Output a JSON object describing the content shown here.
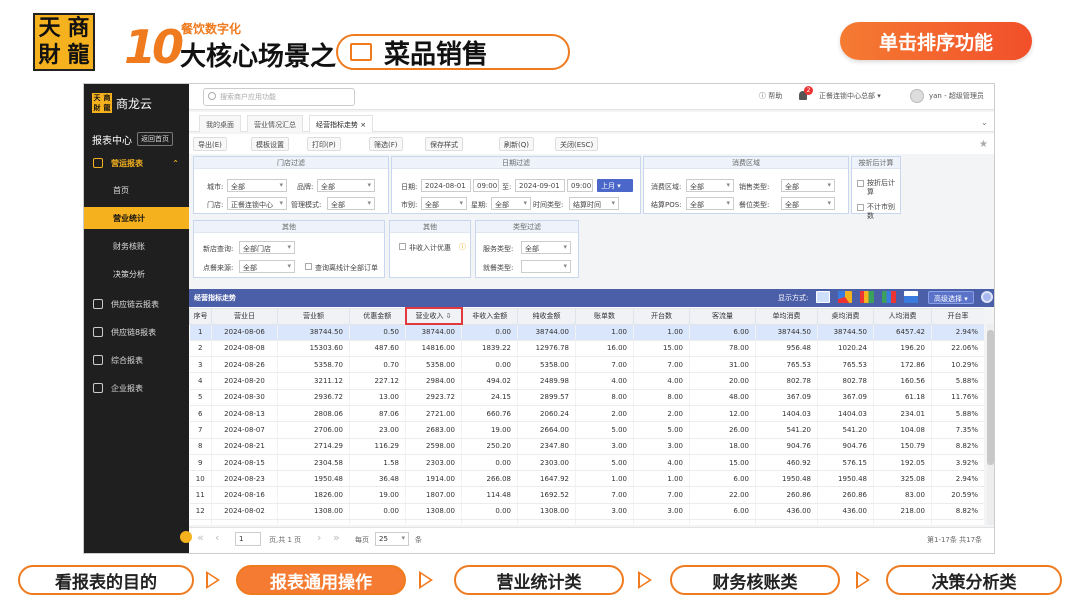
{
  "banner": {
    "logo_chars": [
      "天",
      "商",
      "財",
      "龍"
    ],
    "number": "10",
    "subtitle": "餐饮数字化",
    "title": "大核心场景之",
    "pill_text": "菜品销售",
    "sort_badge": "单击排序功能"
  },
  "sidebar": {
    "brand_chars": [
      "天",
      "商",
      "財",
      "龍"
    ],
    "brand": "商龙云",
    "report_center": "报表中心",
    "home_btn": "返回首页",
    "group": "营运报表",
    "items": [
      {
        "label": "首页",
        "active": false
      },
      {
        "label": "营业统计",
        "active": true
      },
      {
        "label": "财务核账",
        "active": false
      },
      {
        "label": "决策分析",
        "active": false
      }
    ],
    "others": [
      "供应链云报表",
      "供应链8报表",
      "综合报表",
      "企业报表"
    ]
  },
  "topbar": {
    "search_placeholder": "搜索商户应用功能",
    "help": "帮助",
    "bell_count": "2",
    "org": "正餐连锁中心总部",
    "user": "yan - 超级管理员"
  },
  "tabs": [
    "我的桌面",
    "营业情况汇总",
    "经营指标走势"
  ],
  "toolbar": [
    "导出(E)",
    "模板设置",
    "打印(P)",
    "筛选(F)",
    "保存样式",
    "刷新(Q)",
    "关闭(ESC)"
  ],
  "filters": {
    "store": {
      "title": "门店过滤",
      "city_label": "城市:",
      "city": "全部",
      "brand_label": "品牌:",
      "brand": "全部",
      "store_label": "门店:",
      "store": "正餐连锁中心",
      "mgmt_label": "管理模式:",
      "mgmt": "全部"
    },
    "date": {
      "title": "日期过滤",
      "date_label": "日期:",
      "from_date": "2024-08-01",
      "from_time": "09:00",
      "to_label": "至:",
      "to_date": "2024-09-01",
      "to_time": "09:00",
      "month_btn": "上月",
      "meal_label": "市别:",
      "meal": "全部",
      "week_label": "星期:",
      "week": "全部",
      "time_type_label": "时间类型:",
      "time_type": "结算时间"
    },
    "consume": {
      "title": "消费区域",
      "area_label": "消费区域:",
      "area": "全部",
      "sale_type_label": "销售类型:",
      "sale_type": "全部",
      "pos_label": "结算POS:",
      "pos": "全部",
      "seat_label": "餐位类型:",
      "seat": "全部"
    },
    "discount": {
      "title": "按折后计算",
      "opt1": "按折后计算",
      "opt2": "不计市别数"
    },
    "other1": {
      "title": "其他",
      "new_store_label": "新店查询:",
      "new_store": "全部门店",
      "source_label": "点餐来源:",
      "source": "全部",
      "offline_text": "查询离线计全部订单"
    },
    "other2": {
      "title": "其他",
      "opt": "非收入计优惠"
    },
    "type": {
      "title": "类型过滤",
      "service_label": "服务类型:",
      "service": "全部",
      "group_label": "就餐类型:",
      "group": ""
    }
  },
  "grid": {
    "title": "经营指标走势",
    "display_label": "显示方式:",
    "adv_btn": "高级选择",
    "columns": [
      "序号",
      "营业日",
      "营业额",
      "优惠金额",
      "营业收入 ⇩",
      "非收入金额",
      "纯收金额",
      "账单数",
      "开台数",
      "客流量",
      "单均消费",
      "桌均消费",
      "人均消费",
      "开台率"
    ],
    "rows": [
      [
        "1",
        "2024-08-06",
        "38744.50",
        "0.50",
        "38744.00",
        "0.00",
        "38744.00",
        "1.00",
        "1.00",
        "6.00",
        "38744.50",
        "38744.50",
        "6457.42",
        "2.94%"
      ],
      [
        "2",
        "2024-08-08",
        "15303.60",
        "487.60",
        "14816.00",
        "1839.22",
        "12976.78",
        "16.00",
        "15.00",
        "78.00",
        "956.48",
        "1020.24",
        "196.20",
        "22.06%"
      ],
      [
        "3",
        "2024-08-26",
        "5358.70",
        "0.70",
        "5358.00",
        "0.00",
        "5358.00",
        "7.00",
        "7.00",
        "31.00",
        "765.53",
        "765.53",
        "172.86",
        "10.29%"
      ],
      [
        "4",
        "2024-08-20",
        "3211.12",
        "227.12",
        "2984.00",
        "494.02",
        "2489.98",
        "4.00",
        "4.00",
        "20.00",
        "802.78",
        "802.78",
        "160.56",
        "5.88%"
      ],
      [
        "5",
        "2024-08-30",
        "2936.72",
        "13.00",
        "2923.72",
        "24.15",
        "2899.57",
        "8.00",
        "8.00",
        "48.00",
        "367.09",
        "367.09",
        "61.18",
        "11.76%"
      ],
      [
        "6",
        "2024-08-13",
        "2808.06",
        "87.06",
        "2721.00",
        "660.76",
        "2060.24",
        "2.00",
        "2.00",
        "12.00",
        "1404.03",
        "1404.03",
        "234.01",
        "5.88%"
      ],
      [
        "7",
        "2024-08-07",
        "2706.00",
        "23.00",
        "2683.00",
        "19.00",
        "2664.00",
        "5.00",
        "5.00",
        "26.00",
        "541.20",
        "541.20",
        "104.08",
        "7.35%"
      ],
      [
        "8",
        "2024-08-21",
        "2714.29",
        "116.29",
        "2598.00",
        "250.20",
        "2347.80",
        "3.00",
        "3.00",
        "18.00",
        "904.76",
        "904.76",
        "150.79",
        "8.82%"
      ],
      [
        "9",
        "2024-08-15",
        "2304.58",
        "1.58",
        "2303.00",
        "0.00",
        "2303.00",
        "5.00",
        "4.00",
        "15.00",
        "460.92",
        "576.15",
        "192.05",
        "3.92%"
      ],
      [
        "10",
        "2024-08-23",
        "1950.48",
        "36.48",
        "1914.00",
        "266.08",
        "1647.92",
        "1.00",
        "1.00",
        "6.00",
        "1950.48",
        "1950.48",
        "325.08",
        "2.94%"
      ],
      [
        "11",
        "2024-08-16",
        "1826.00",
        "19.00",
        "1807.00",
        "114.48",
        "1692.52",
        "7.00",
        "7.00",
        "22.00",
        "260.86",
        "260.86",
        "83.00",
        "20.59%"
      ],
      [
        "12",
        "2024-08-02",
        "1308.00",
        "0.00",
        "1308.00",
        "0.00",
        "1308.00",
        "3.00",
        "3.00",
        "6.00",
        "436.00",
        "436.00",
        "218.00",
        "8.82%"
      ],
      [
        "13",
        "2024-08-28",
        "742.00",
        "0.00",
        "742.00",
        "0.00",
        "742.00",
        "1.00",
        "1.00",
        "6.00",
        "742.00",
        "742.00",
        "123.67",
        "2.94%"
      ]
    ]
  },
  "pager": {
    "page": "1",
    "pages_text": "页,共 1 页",
    "per_page_label": "每页",
    "per_page": "25",
    "unit": "条",
    "summary": "第1-17条 共17条"
  },
  "bottom_nav": [
    {
      "label": "看报表的目的",
      "active": false
    },
    {
      "label": "报表通用操作",
      "active": true
    },
    {
      "label": "营业统计类",
      "active": false
    },
    {
      "label": "财务核账类",
      "active": false
    },
    {
      "label": "决策分析类",
      "active": false
    }
  ]
}
